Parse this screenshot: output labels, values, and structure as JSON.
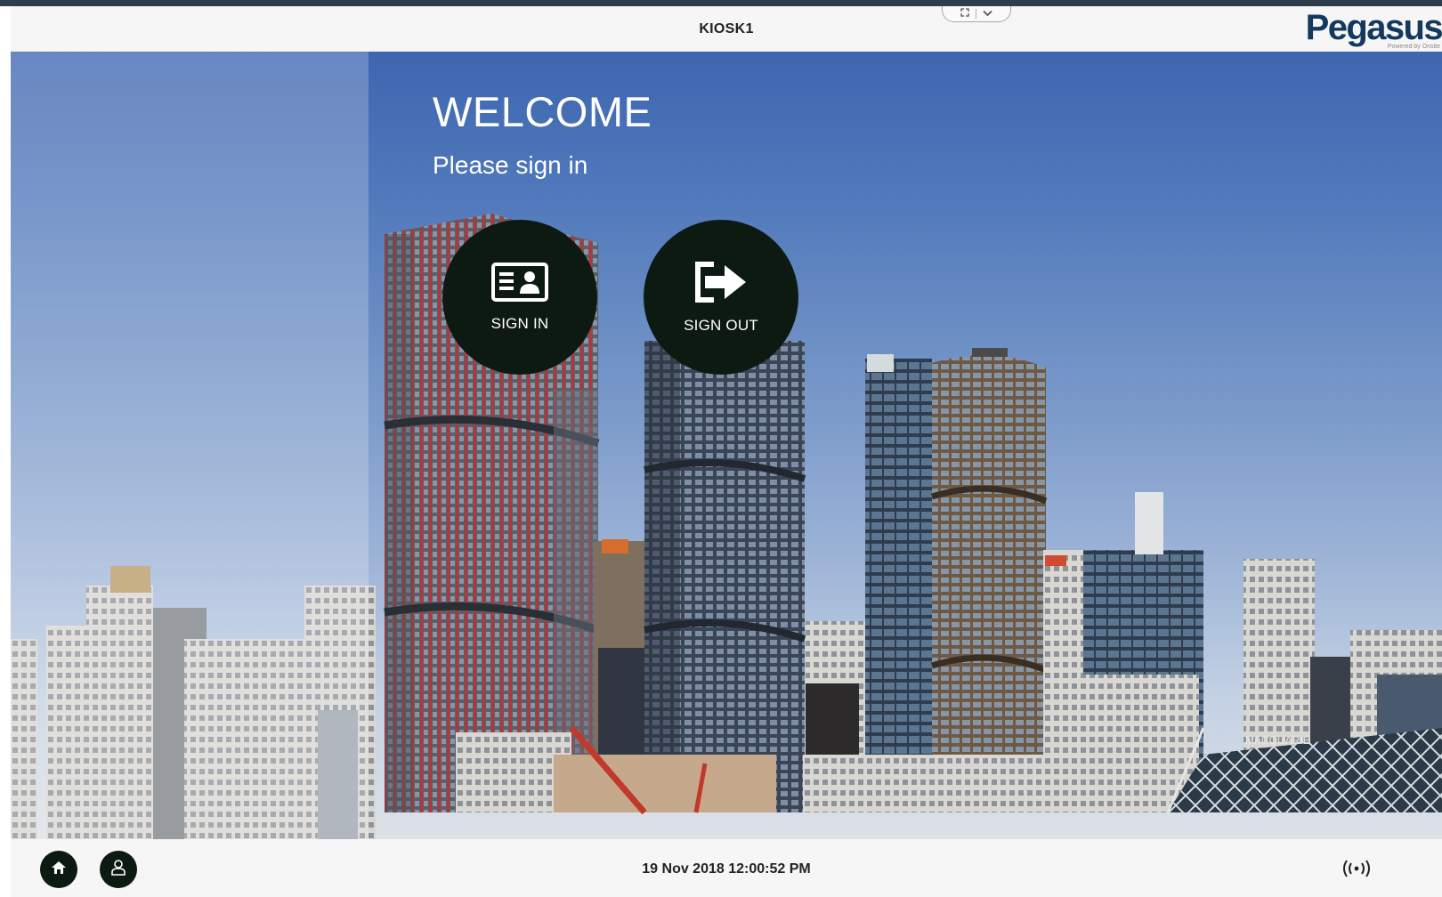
{
  "header": {
    "kiosk_name": "KIOSK1",
    "brand": "Pegasus",
    "brand_tagline": "Powered by Onsite"
  },
  "window_controls": {
    "icons": [
      "fullscreen-icon",
      "chevron-down-icon"
    ]
  },
  "main": {
    "welcome_title": "WELCOME",
    "welcome_subtitle": "Please sign in",
    "sign_in_label": "SIGN IN",
    "sign_out_label": "SIGN OUT",
    "sign_in_icon": "id-card-icon",
    "sign_out_icon": "exit-arrow-icon"
  },
  "footer": {
    "datetime": "19 Nov 2018 12:00:52 PM",
    "home_icon": "home-icon",
    "user_icon": "user-icon",
    "signal_icon": "nfc-signal-icon"
  },
  "colors": {
    "top_strip": "#2e3e4c",
    "brand": "#14395e",
    "button_fill": "#0d1a12",
    "header_bg": "#f6f6f6",
    "sky_top": "#3e66b0"
  }
}
